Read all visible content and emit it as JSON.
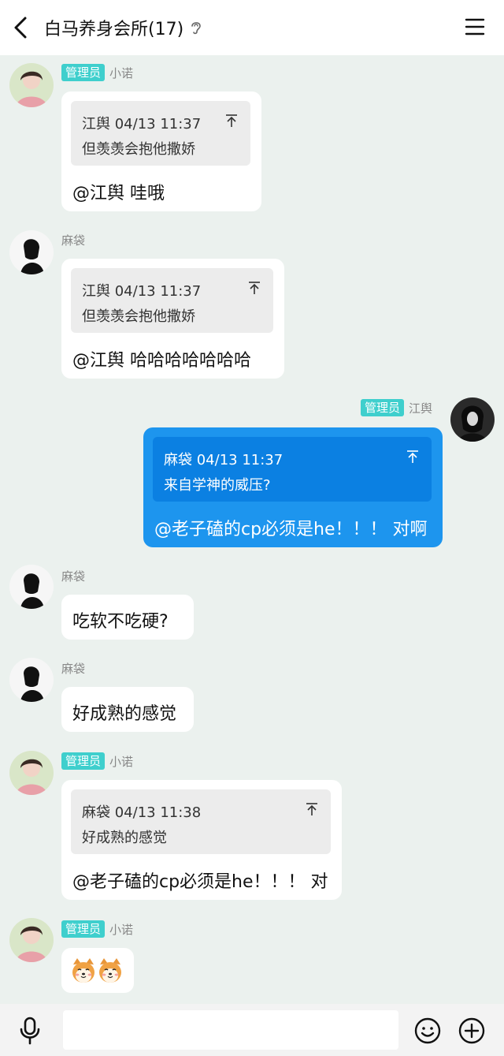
{
  "header": {
    "title": "白马养身会所(17)",
    "back_icon": "chevron-left-icon",
    "ear_icon": "ear-icon",
    "menu_icon": "hamburger-menu-icon"
  },
  "messages": [
    {
      "sender": "小诺",
      "badge": "管理员",
      "side": "left",
      "quote": {
        "head": "江舆 04/13 11:37",
        "text": "但羡羡会抱他撒娇"
      },
      "text": "@江舆 哇哦"
    },
    {
      "sender": "麻袋",
      "side": "left",
      "quote": {
        "head": "江舆 04/13 11:37",
        "text": "但羡羡会抱他撒娇"
      },
      "text": "@江舆 哈哈哈哈哈哈哈"
    },
    {
      "sender": "江舆",
      "badge": "管理员",
      "side": "right",
      "quote": {
        "head": "麻袋 04/13 11:37",
        "text": "来自学神的威压?"
      },
      "text": "@老子磕的cp必须是he！！！ 对啊"
    },
    {
      "sender": "麻袋",
      "side": "left",
      "text": "吃软不吃硬?"
    },
    {
      "sender": "麻袋",
      "side": "left",
      "text": "好成熟的感觉"
    },
    {
      "sender": "小诺",
      "badge": "管理员",
      "side": "left",
      "quote": {
        "head": "麻袋 04/13 11:38",
        "text": "好成熟的感觉"
      },
      "text": "@老子磕的cp必须是he！！！ 对"
    },
    {
      "sender": "小诺",
      "badge": "管理员",
      "side": "left",
      "text": "🐶🐶",
      "emoji": "shiba-dog-face-emoji"
    }
  ],
  "input_bar": {
    "placeholder": "",
    "mic_icon": "microphone-icon",
    "emoji_icon": "smiley-face-icon",
    "plus_icon": "plus-circle-icon"
  },
  "colors": {
    "background": "#ebf1ee",
    "admin_badge": "#3fcfcd",
    "my_bubble": "#1d95ee"
  }
}
